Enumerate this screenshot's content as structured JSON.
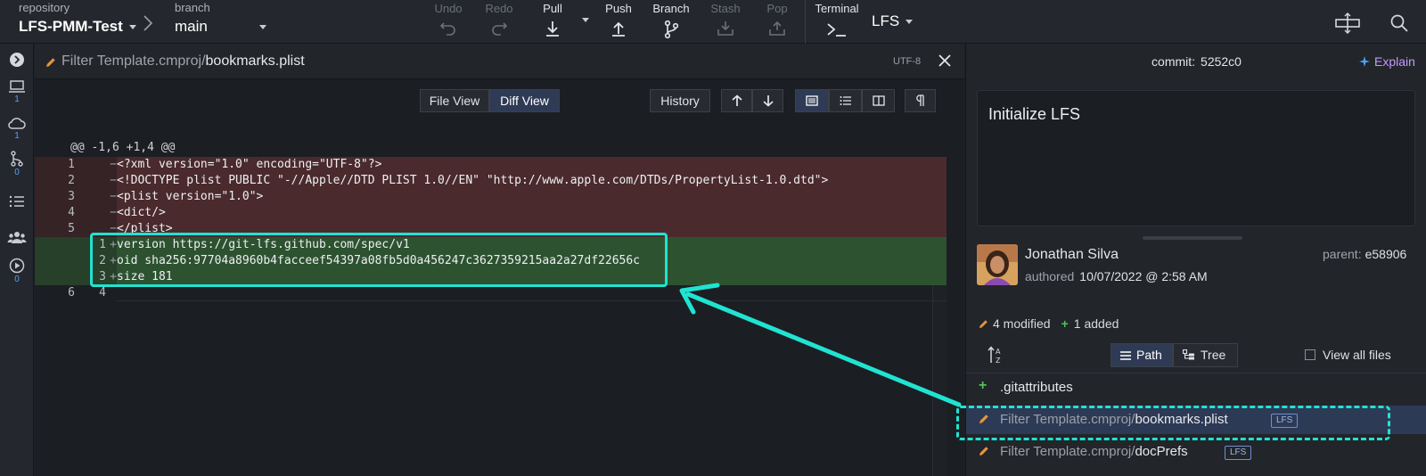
{
  "toolbar": {
    "repo_label": "repository",
    "repo_name": "LFS-PMM-Test",
    "branch_label": "branch",
    "branch_name": "main",
    "undo": "Undo",
    "redo": "Redo",
    "pull": "Pull",
    "push": "Push",
    "branch": "Branch",
    "stash": "Stash",
    "pop": "Pop",
    "terminal": "Terminal",
    "lfs_menu": "LFS"
  },
  "rail": {
    "local_count": "1",
    "remote_count": "1",
    "pr_count": "0",
    "actions_count": "0"
  },
  "file_view": {
    "path_dir": "Filter Template.cmproj/",
    "path_file": "bookmarks.plist",
    "encoding": "UTF-8",
    "file_view_btn": "File View",
    "diff_view_btn": "Diff View",
    "history_btn": "History",
    "hunk_header": "@@ -1,6 +1,4 @@",
    "lines": [
      {
        "type": "del",
        "old": "1",
        "new": "",
        "marker": "−",
        "text": "<?xml version=\"1.0\" encoding=\"UTF-8\"?>"
      },
      {
        "type": "del",
        "old": "2",
        "new": "",
        "marker": "−",
        "text": "<!DOCTYPE plist PUBLIC \"-//Apple//DTD PLIST 1.0//EN\" \"http://www.apple.com/DTDs/PropertyList-1.0.dtd\">"
      },
      {
        "type": "del",
        "old": "3",
        "new": "",
        "marker": "−",
        "text": "<plist version=\"1.0\">"
      },
      {
        "type": "del",
        "old": "4",
        "new": "",
        "marker": "−",
        "text": "<dict/>"
      },
      {
        "type": "del",
        "old": "5",
        "new": "",
        "marker": "−",
        "text": "</plist>"
      },
      {
        "type": "add",
        "old": "",
        "new": "1",
        "marker": "+",
        "text": "version https://git-lfs.github.com/spec/v1"
      },
      {
        "type": "add",
        "old": "",
        "new": "2",
        "marker": "+",
        "text": "oid sha256:97704a8960b4facceef54397a08fb5d0a456247c3627359215aa2a27df22656c"
      },
      {
        "type": "add",
        "old": "",
        "new": "3",
        "marker": "+",
        "text": "size 181"
      },
      {
        "type": "ctx",
        "old": "6",
        "new": "4",
        "marker": "",
        "text": ""
      }
    ]
  },
  "commit": {
    "label": "commit:",
    "sha": "5252c0",
    "explain": "Explain",
    "message": "Initialize LFS",
    "author": "Jonathan Silva",
    "authored_label": "authored",
    "authored_date": "10/07/2022 @ 2:58 AM",
    "parent_label": "parent:",
    "parent_sha": "e58906",
    "modified": "4 modified",
    "added": "1 added",
    "path_btn": "Path",
    "tree_btn": "Tree",
    "view_all": "View all files",
    "files": [
      {
        "status": "added",
        "dir": "",
        "name": ".gitattributes",
        "lfs": ""
      },
      {
        "status": "modified",
        "dir": "Filter Template.cmproj/",
        "name": "bookmarks.plist",
        "lfs": "LFS"
      },
      {
        "status": "modified",
        "dir": "Filter Template.cmproj/",
        "name": "docPrefs",
        "lfs": "LFS"
      }
    ]
  },
  "colors": {
    "annotation": "#20e3d2",
    "deleted_bg": "#4a2a2d",
    "added_bg": "#2d5230",
    "accent": "#2f3b55"
  }
}
